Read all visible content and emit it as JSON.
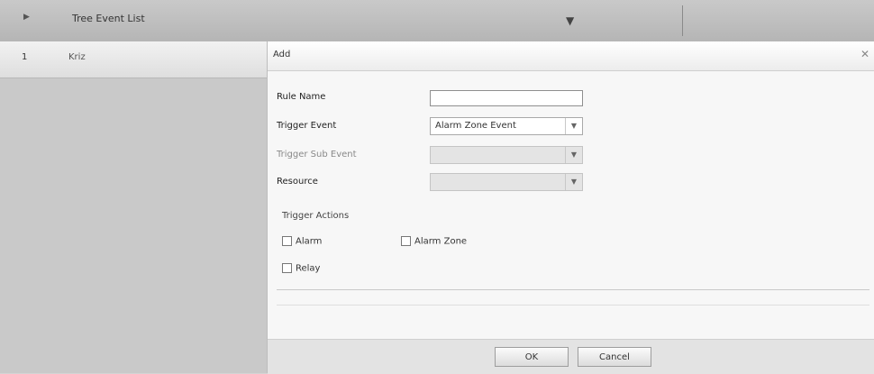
{
  "topbar": {
    "expand_icon": "expand-arrow-icon",
    "title": "Tree Event List",
    "down_icon": "down-arrow-icon"
  },
  "left_panel": {
    "row_mark": "1",
    "row_label": "Kriz"
  },
  "dialog": {
    "title": "Add",
    "close_icon": "close-icon",
    "fields": {
      "rule_name": {
        "label": "Rule Name",
        "value": ""
      },
      "trigger_event": {
        "label": "Trigger Event",
        "value": "Alarm Zone Event"
      },
      "trigger_sub_event": {
        "label": "Trigger Sub Event",
        "value": ""
      },
      "resource": {
        "label": "Resource",
        "value": ""
      }
    },
    "trigger_actions": {
      "label": "Trigger Actions",
      "items": [
        "Alarm",
        "Alarm Zone",
        "Relay"
      ]
    },
    "buttons": {
      "ok": "OK",
      "cancel": "Cancel"
    }
  },
  "colors": {
    "header_bg": "#c2c2c2",
    "dialog_bg": "#f7f7f7",
    "disabled_field": "#e4e4e4"
  }
}
